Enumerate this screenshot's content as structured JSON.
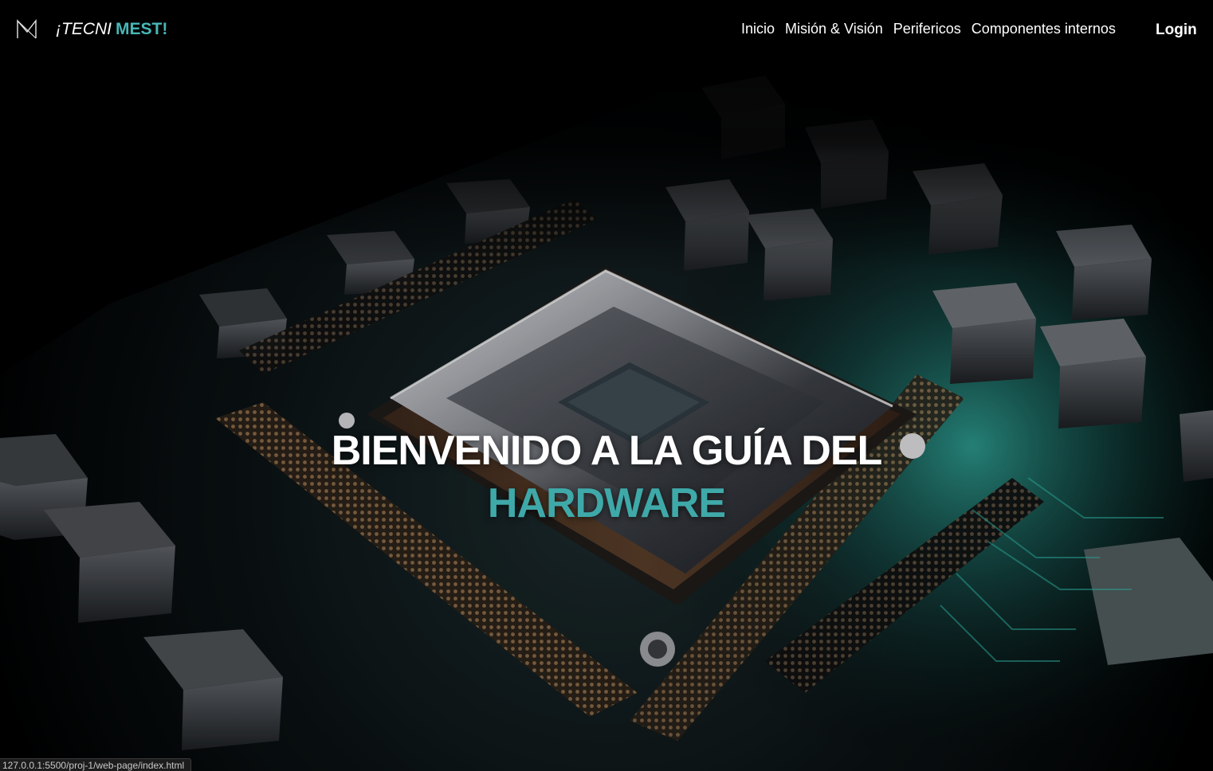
{
  "brand": {
    "part1": "¡TECNI",
    "part2": "MEST!",
    "logo_icon": "m-monogram-icon",
    "accent_color": "#48b7b7"
  },
  "nav": {
    "links": [
      {
        "label": "Inicio"
      },
      {
        "label": "Misión & Visión"
      },
      {
        "label": "Perifericos"
      },
      {
        "label": "Componentes internos"
      }
    ],
    "login_label": "Login"
  },
  "hero": {
    "line1": "BIENVENIDO A LA GUÍA DEL",
    "line2": "HARDWARE",
    "background_image": "cpu-motherboard-image",
    "line2_color": "#3fa9a9"
  },
  "status_bar": {
    "url": "127.0.0.1:5500/proj-1/web-page/index.html"
  }
}
